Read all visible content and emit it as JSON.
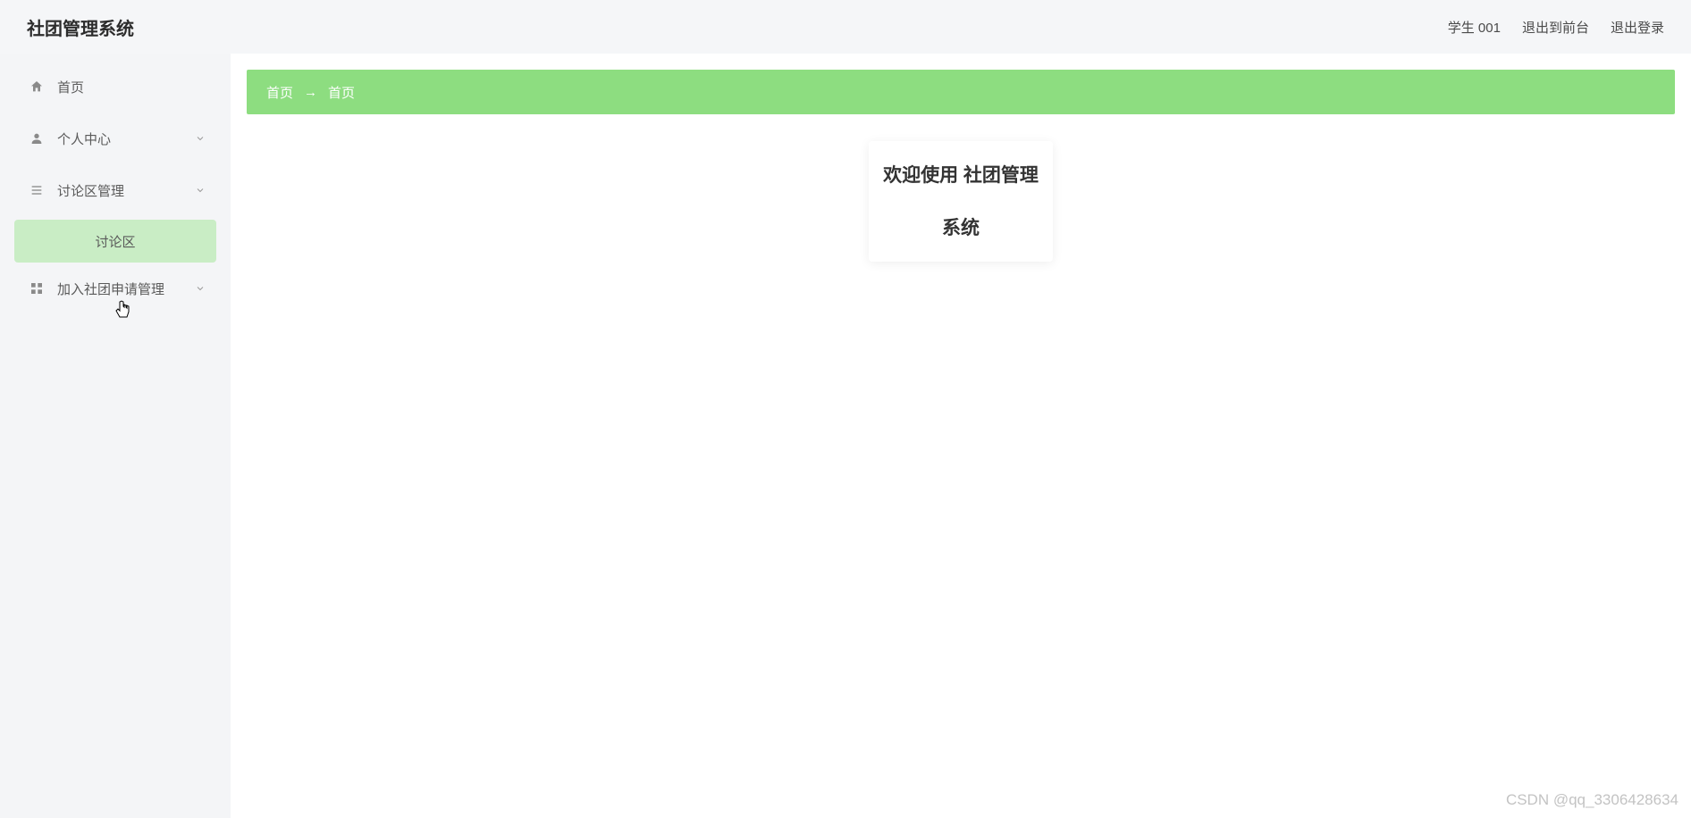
{
  "header": {
    "title": "社团管理系统",
    "user_label": "学生 001",
    "exit_front_label": "退出到前台",
    "logout_label": "退出登录"
  },
  "sidebar": {
    "items": [
      {
        "icon": "home-icon",
        "label": "首页",
        "has_children": false
      },
      {
        "icon": "user-icon",
        "label": "个人中心",
        "has_children": true
      },
      {
        "icon": "list-icon",
        "label": "讨论区管理",
        "has_children": true
      },
      {
        "icon": "grid-icon",
        "label": "加入社团申请管理",
        "has_children": true
      }
    ],
    "subitem": {
      "label": "讨论区"
    }
  },
  "breadcrumb": {
    "home": "首页",
    "separator": "→",
    "current": "首页"
  },
  "welcome": {
    "line1": "欢迎使用 社团管理",
    "line2": "系统"
  },
  "watermark": "CSDN @qq_3306428634"
}
